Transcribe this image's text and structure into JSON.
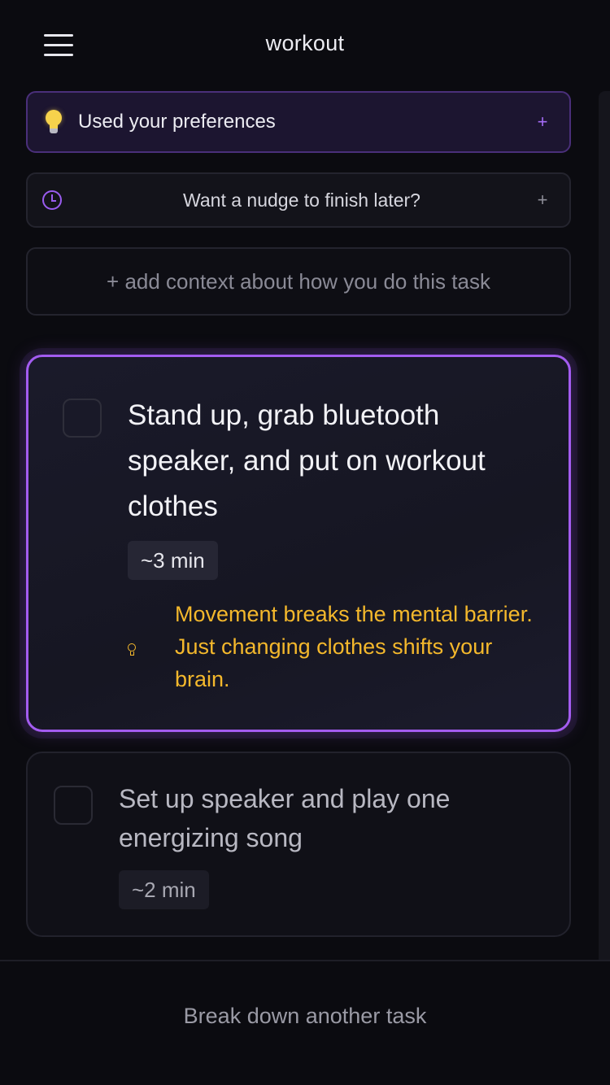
{
  "header": {
    "title": "workout"
  },
  "preferences": {
    "label": "Used your preferences",
    "plus": "+"
  },
  "nudge": {
    "label": "Want a nudge to finish later?",
    "plus": "+"
  },
  "context": {
    "label": "+ add context about how you do this task"
  },
  "tasks": [
    {
      "text": "Stand up, grab bluetooth speaker, and put on workout clothes",
      "time": "~3 min",
      "tip": "Movement breaks the mental barrier. Just changing clothes shifts your brain.",
      "active": true
    },
    {
      "text": "Set up speaker and play one energizing song",
      "time": "~2 min",
      "active": false
    }
  ],
  "footer": {
    "button_label": "Break down another task"
  },
  "colors": {
    "accent": "#a35cf0",
    "tip": "#f4b82c",
    "background": "#0b0b10"
  },
  "icons": {
    "menu": "hamburger-menu-icon",
    "preferences": "lightbulb-icon",
    "nudge": "clock-icon",
    "tip": "lightbulb-outline-icon"
  }
}
